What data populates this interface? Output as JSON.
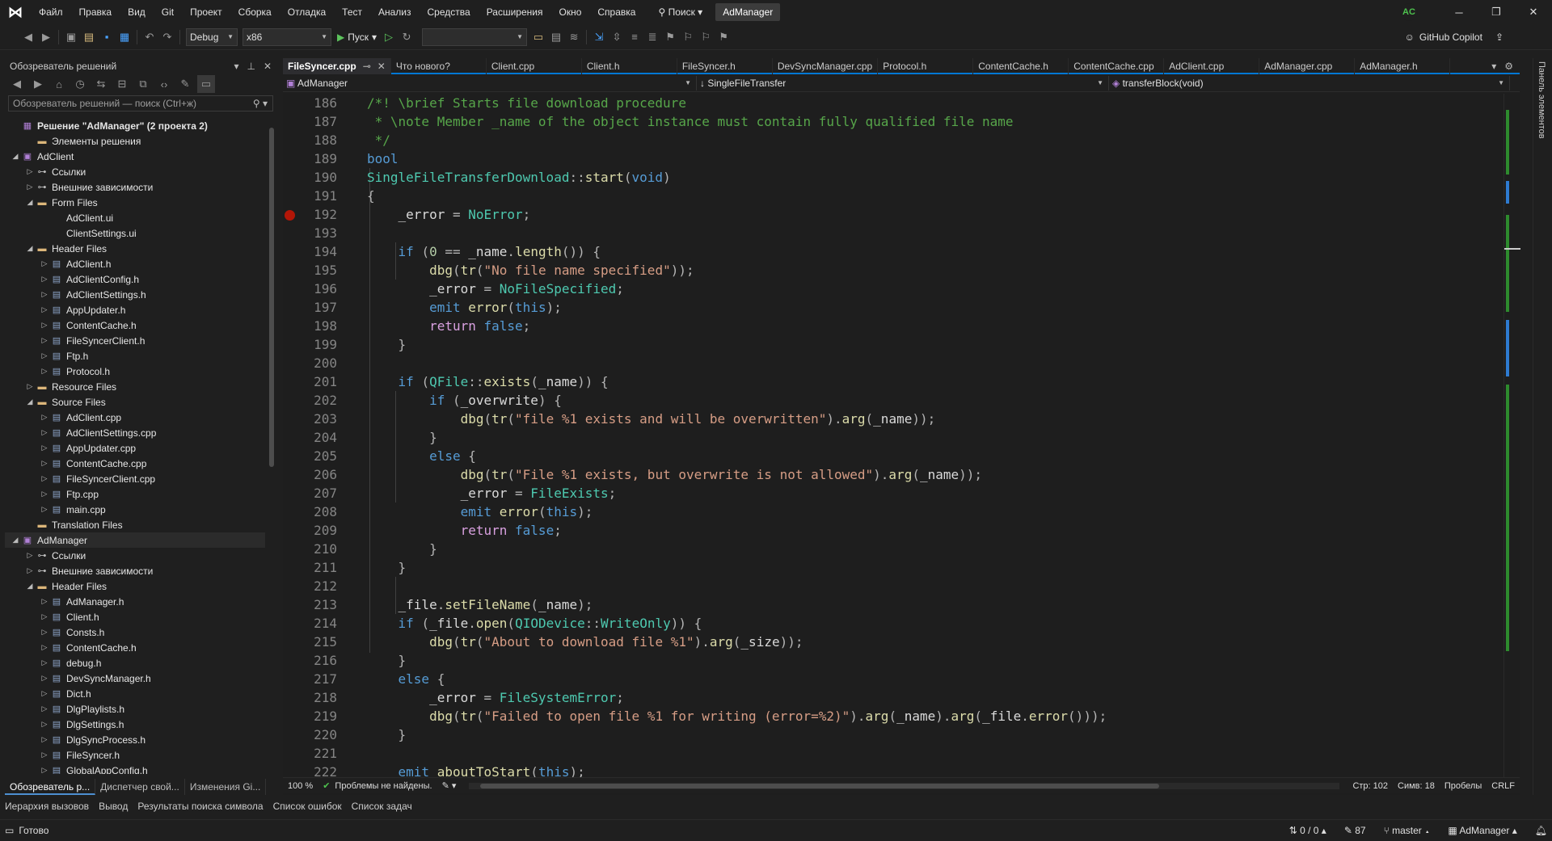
{
  "menu": [
    "Файл",
    "Правка",
    "Вид",
    "Git",
    "Проект",
    "Сборка",
    "Отладка",
    "Тест",
    "Анализ",
    "Средства",
    "Расширения",
    "Окно",
    "Справка"
  ],
  "search_label": "Поиск",
  "app_title": "AdManager",
  "user_initials": "AC",
  "toolbar": {
    "config": "Debug",
    "platform": "x86",
    "run_label": "Пуск",
    "copilot_label": "GitHub Copilot"
  },
  "solution_explorer": {
    "title": "Обозреватель решений",
    "search_placeholder": "Обозреватель решений — поиск (Ctrl+ж)",
    "tree": [
      {
        "t": "Решение \"AdManager\"  (2 проекта 2)",
        "lvl": 0,
        "kind": "sol",
        "exp": "",
        "bold": true
      },
      {
        "t": "Элементы решения",
        "lvl": 1,
        "kind": "folder",
        "exp": ""
      },
      {
        "t": "AdClient",
        "lvl": 0,
        "kind": "proj",
        "exp": "◢"
      },
      {
        "t": "Ссылки",
        "lvl": 1,
        "kind": "ref",
        "exp": "▷"
      },
      {
        "t": "Внешние зависимости",
        "lvl": 1,
        "kind": "ref",
        "exp": "▷"
      },
      {
        "t": "Form Files",
        "lvl": 1,
        "kind": "folder",
        "exp": "◢"
      },
      {
        "t": "AdClient.ui",
        "lvl": 2,
        "kind": "none",
        "exp": ""
      },
      {
        "t": "ClientSettings.ui",
        "lvl": 2,
        "kind": "none",
        "exp": ""
      },
      {
        "t": "Header Files",
        "lvl": 1,
        "kind": "folder",
        "exp": "◢"
      },
      {
        "t": "AdClient.h",
        "lvl": 2,
        "kind": "file",
        "exp": "▷"
      },
      {
        "t": "AdClientConfig.h",
        "lvl": 2,
        "kind": "file",
        "exp": "▷"
      },
      {
        "t": "AdClientSettings.h",
        "lvl": 2,
        "kind": "file",
        "exp": "▷"
      },
      {
        "t": "AppUpdater.h",
        "lvl": 2,
        "kind": "file",
        "exp": "▷"
      },
      {
        "t": "ContentCache.h",
        "lvl": 2,
        "kind": "file",
        "exp": "▷"
      },
      {
        "t": "FileSyncerClient.h",
        "lvl": 2,
        "kind": "file",
        "exp": "▷"
      },
      {
        "t": "Ftp.h",
        "lvl": 2,
        "kind": "file",
        "exp": "▷"
      },
      {
        "t": "Protocol.h",
        "lvl": 2,
        "kind": "file",
        "exp": "▷"
      },
      {
        "t": "Resource Files",
        "lvl": 1,
        "kind": "folder",
        "exp": "▷"
      },
      {
        "t": "Source Files",
        "lvl": 1,
        "kind": "folder",
        "exp": "◢"
      },
      {
        "t": "AdClient.cpp",
        "lvl": 2,
        "kind": "file",
        "exp": "▷"
      },
      {
        "t": "AdClientSettings.cpp",
        "lvl": 2,
        "kind": "file",
        "exp": "▷"
      },
      {
        "t": "AppUpdater.cpp",
        "lvl": 2,
        "kind": "file",
        "exp": "▷"
      },
      {
        "t": "ContentCache.cpp",
        "lvl": 2,
        "kind": "file",
        "exp": "▷"
      },
      {
        "t": "FileSyncerClient.cpp",
        "lvl": 2,
        "kind": "file",
        "exp": "▷"
      },
      {
        "t": "Ftp.cpp",
        "lvl": 2,
        "kind": "file",
        "exp": "▷"
      },
      {
        "t": "main.cpp",
        "lvl": 2,
        "kind": "file",
        "exp": "▷"
      },
      {
        "t": "Translation Files",
        "lvl": 1,
        "kind": "folder",
        "exp": ""
      },
      {
        "t": "AdManager",
        "lvl": 0,
        "kind": "proj",
        "exp": "◢",
        "selected": true
      },
      {
        "t": "Ссылки",
        "lvl": 1,
        "kind": "ref",
        "exp": "▷"
      },
      {
        "t": "Внешние зависимости",
        "lvl": 1,
        "kind": "ref",
        "exp": "▷"
      },
      {
        "t": "Header Files",
        "lvl": 1,
        "kind": "folder",
        "exp": "◢"
      },
      {
        "t": "AdManager.h",
        "lvl": 2,
        "kind": "file",
        "exp": "▷"
      },
      {
        "t": "Client.h",
        "lvl": 2,
        "kind": "file",
        "exp": "▷"
      },
      {
        "t": "Consts.h",
        "lvl": 2,
        "kind": "file",
        "exp": "▷"
      },
      {
        "t": "ContentCache.h",
        "lvl": 2,
        "kind": "file",
        "exp": "▷"
      },
      {
        "t": "debug.h",
        "lvl": 2,
        "kind": "file",
        "exp": "▷"
      },
      {
        "t": "DevSyncManager.h",
        "lvl": 2,
        "kind": "file",
        "exp": "▷"
      },
      {
        "t": "Dict.h",
        "lvl": 2,
        "kind": "file",
        "exp": "▷"
      },
      {
        "t": "DlgPlaylists.h",
        "lvl": 2,
        "kind": "file",
        "exp": "▷"
      },
      {
        "t": "DlgSettings.h",
        "lvl": 2,
        "kind": "file",
        "exp": "▷"
      },
      {
        "t": "DlgSyncProcess.h",
        "lvl": 2,
        "kind": "file",
        "exp": "▷"
      },
      {
        "t": "FileSyncer.h",
        "lvl": 2,
        "kind": "file",
        "exp": "▷"
      },
      {
        "t": "GlobalAppConfig.h",
        "lvl": 2,
        "kind": "file",
        "exp": "▷"
      }
    ],
    "tabs": [
      "Обозреватель р...",
      "Диспетчер свой...",
      "Изменения Gi..."
    ]
  },
  "doc_tabs": [
    "FileSyncer.cpp",
    "Что нового?",
    "Client.cpp",
    "Client.h",
    "FileSyncer.h",
    "DevSyncManager.cpp",
    "Protocol.h",
    "ContentCache.h",
    "ContentCache.cpp",
    "AdClient.cpp",
    "AdManager.cpp",
    "AdManager.h"
  ],
  "nav": {
    "project": "AdManager",
    "scope": "SingleFileTransfer",
    "member": "transferBlock(void)"
  },
  "code": [
    {
      "n": "186",
      "s": [
        [
          "c-com",
          "/*! \\brief Starts file download procedure"
        ]
      ]
    },
    {
      "n": "187",
      "s": [
        [
          "c-com",
          " * \\note Member _name of the object instance must contain fully qualified file name"
        ]
      ]
    },
    {
      "n": "188",
      "s": [
        [
          "c-com",
          " */"
        ]
      ]
    },
    {
      "n": "189",
      "s": [
        [
          "c-kw",
          "bool"
        ]
      ]
    },
    {
      "n": "190",
      "s": [
        [
          "c-ty",
          "SingleFileTransferDownload"
        ],
        [
          "c-punc",
          "::"
        ],
        [
          "c-fn",
          "start"
        ],
        [
          "c-punc",
          "("
        ],
        [
          "c-kw",
          "void"
        ],
        [
          "c-punc",
          ")"
        ]
      ]
    },
    {
      "n": "191",
      "s": [
        [
          "c-punc",
          "{"
        ]
      ]
    },
    {
      "n": "192",
      "bp": true,
      "s": [
        [
          "c-var",
          "    _error "
        ],
        [
          "c-punc",
          "= "
        ],
        [
          "c-ty",
          "NoError"
        ],
        [
          "c-punc",
          ";"
        ]
      ]
    },
    {
      "n": "193",
      "s": []
    },
    {
      "n": "194",
      "s": [
        [
          "c-kw",
          "    if "
        ],
        [
          "c-punc",
          "("
        ],
        [
          "c-num",
          "0"
        ],
        [
          "c-punc",
          " == "
        ],
        [
          "c-var",
          "_name"
        ],
        [
          "c-punc",
          "."
        ],
        [
          "c-fn",
          "length"
        ],
        [
          "c-punc",
          "()) {"
        ]
      ]
    },
    {
      "n": "195",
      "s": [
        [
          "c-fn",
          "        dbg"
        ],
        [
          "c-punc",
          "("
        ],
        [
          "c-fn",
          "tr"
        ],
        [
          "c-punc",
          "("
        ],
        [
          "c-str",
          "\"No file name specified\""
        ],
        [
          "c-punc",
          "));"
        ]
      ]
    },
    {
      "n": "196",
      "s": [
        [
          "c-var",
          "        _error "
        ],
        [
          "c-punc",
          "= "
        ],
        [
          "c-ty",
          "NoFileSpecified"
        ],
        [
          "c-punc",
          ";"
        ]
      ]
    },
    {
      "n": "197",
      "s": [
        [
          "c-kw",
          "        emit "
        ],
        [
          "c-fn",
          "error"
        ],
        [
          "c-punc",
          "("
        ],
        [
          "c-kw",
          "this"
        ],
        [
          "c-punc",
          ");"
        ]
      ]
    },
    {
      "n": "198",
      "s": [
        [
          "c-ctrl",
          "        return "
        ],
        [
          "c-kw",
          "false"
        ],
        [
          "c-punc",
          ";"
        ]
      ]
    },
    {
      "n": "199",
      "s": [
        [
          "c-punc",
          "    }"
        ]
      ]
    },
    {
      "n": "200",
      "s": []
    },
    {
      "n": "201",
      "s": [
        [
          "c-kw",
          "    if "
        ],
        [
          "c-punc",
          "("
        ],
        [
          "c-ty",
          "QFile"
        ],
        [
          "c-punc",
          "::"
        ],
        [
          "c-fn",
          "exists"
        ],
        [
          "c-punc",
          "("
        ],
        [
          "c-var",
          "_name"
        ],
        [
          "c-punc",
          ")) {"
        ]
      ]
    },
    {
      "n": "202",
      "s": [
        [
          "c-kw",
          "        if "
        ],
        [
          "c-punc",
          "("
        ],
        [
          "c-var",
          "_overwrite"
        ],
        [
          "c-punc",
          ") {"
        ]
      ]
    },
    {
      "n": "203",
      "s": [
        [
          "c-fn",
          "            dbg"
        ],
        [
          "c-punc",
          "("
        ],
        [
          "c-fn",
          "tr"
        ],
        [
          "c-punc",
          "("
        ],
        [
          "c-str",
          "\"file %1 exists and will be overwritten\""
        ],
        [
          "c-punc",
          ")."
        ],
        [
          "c-fn",
          "arg"
        ],
        [
          "c-punc",
          "("
        ],
        [
          "c-var",
          "_name"
        ],
        [
          "c-punc",
          "));"
        ]
      ]
    },
    {
      "n": "204",
      "s": [
        [
          "c-punc",
          "        }"
        ]
      ]
    },
    {
      "n": "205",
      "s": [
        [
          "c-kw",
          "        else "
        ],
        [
          "c-punc",
          "{"
        ]
      ]
    },
    {
      "n": "206",
      "s": [
        [
          "c-fn",
          "            dbg"
        ],
        [
          "c-punc",
          "("
        ],
        [
          "c-fn",
          "tr"
        ],
        [
          "c-punc",
          "("
        ],
        [
          "c-str",
          "\"File %1 exists, but overwrite is not allowed\""
        ],
        [
          "c-punc",
          ")."
        ],
        [
          "c-fn",
          "arg"
        ],
        [
          "c-punc",
          "("
        ],
        [
          "c-var",
          "_name"
        ],
        [
          "c-punc",
          "));"
        ]
      ]
    },
    {
      "n": "207",
      "s": [
        [
          "c-var",
          "            _error "
        ],
        [
          "c-punc",
          "= "
        ],
        [
          "c-ty",
          "FileExists"
        ],
        [
          "c-punc",
          ";"
        ]
      ]
    },
    {
      "n": "208",
      "s": [
        [
          "c-kw",
          "            emit "
        ],
        [
          "c-fn",
          "error"
        ],
        [
          "c-punc",
          "("
        ],
        [
          "c-kw",
          "this"
        ],
        [
          "c-punc",
          ");"
        ]
      ]
    },
    {
      "n": "209",
      "s": [
        [
          "c-ctrl",
          "            return "
        ],
        [
          "c-kw",
          "false"
        ],
        [
          "c-punc",
          ";"
        ]
      ]
    },
    {
      "n": "210",
      "s": [
        [
          "c-punc",
          "        }"
        ]
      ]
    },
    {
      "n": "211",
      "s": [
        [
          "c-punc",
          "    }"
        ]
      ]
    },
    {
      "n": "212",
      "s": []
    },
    {
      "n": "213",
      "s": [
        [
          "c-var",
          "    _file"
        ],
        [
          "c-punc",
          "."
        ],
        [
          "c-fn",
          "setFileName"
        ],
        [
          "c-punc",
          "("
        ],
        [
          "c-var",
          "_name"
        ],
        [
          "c-punc",
          ");"
        ]
      ]
    },
    {
      "n": "214",
      "s": [
        [
          "c-kw",
          "    if "
        ],
        [
          "c-punc",
          "("
        ],
        [
          "c-var",
          "_file"
        ],
        [
          "c-punc",
          "."
        ],
        [
          "c-fn",
          "open"
        ],
        [
          "c-punc",
          "("
        ],
        [
          "c-ty",
          "QIODevice"
        ],
        [
          "c-punc",
          "::"
        ],
        [
          "c-ty",
          "WriteOnly"
        ],
        [
          "c-punc",
          ")) {"
        ]
      ]
    },
    {
      "n": "215",
      "s": [
        [
          "c-fn",
          "        dbg"
        ],
        [
          "c-punc",
          "("
        ],
        [
          "c-fn",
          "tr"
        ],
        [
          "c-punc",
          "("
        ],
        [
          "c-str",
          "\"About to download file %1\""
        ],
        [
          "c-punc",
          ")."
        ],
        [
          "c-fn",
          "arg"
        ],
        [
          "c-punc",
          "("
        ],
        [
          "c-var",
          "_size"
        ],
        [
          "c-punc",
          "));"
        ]
      ]
    },
    {
      "n": "216",
      "s": [
        [
          "c-punc",
          "    }"
        ]
      ]
    },
    {
      "n": "217",
      "s": [
        [
          "c-kw",
          "    else "
        ],
        [
          "c-punc",
          "{"
        ]
      ]
    },
    {
      "n": "218",
      "s": [
        [
          "c-var",
          "        _error "
        ],
        [
          "c-punc",
          "= "
        ],
        [
          "c-ty",
          "FileSystemError"
        ],
        [
          "c-punc",
          ";"
        ]
      ]
    },
    {
      "n": "219",
      "s": [
        [
          "c-fn",
          "        dbg"
        ],
        [
          "c-punc",
          "("
        ],
        [
          "c-fn",
          "tr"
        ],
        [
          "c-punc",
          "("
        ],
        [
          "c-str",
          "\"Failed to open file %1 for writing (error=%2)\""
        ],
        [
          "c-punc",
          ")."
        ],
        [
          "c-fn",
          "arg"
        ],
        [
          "c-punc",
          "("
        ],
        [
          "c-var",
          "_name"
        ],
        [
          "c-punc",
          ")."
        ],
        [
          "c-fn",
          "arg"
        ],
        [
          "c-punc",
          "("
        ],
        [
          "c-var",
          "_file"
        ],
        [
          "c-punc",
          "."
        ],
        [
          "c-fn",
          "error"
        ],
        [
          "c-punc",
          "()));"
        ]
      ]
    },
    {
      "n": "220",
      "s": [
        [
          "c-punc",
          "    }"
        ]
      ]
    },
    {
      "n": "221",
      "s": []
    },
    {
      "n": "222",
      "s": [
        [
          "c-kw",
          "    emit "
        ],
        [
          "c-fn",
          "aboutToStart"
        ],
        [
          "c-punc",
          "("
        ],
        [
          "c-kw",
          "this"
        ],
        [
          "c-punc",
          ");"
        ]
      ]
    }
  ],
  "editor_status": {
    "zoom": "100 %",
    "problems": "Проблемы не найдены.",
    "line": "Стр: 102",
    "col": "Симв: 18",
    "whitespace": "Пробелы",
    "eol": "CRLF"
  },
  "right_panel_label": "Панель элементов",
  "bottom_tabs": [
    "Иерархия вызовов",
    "Вывод",
    "Результаты поиска символа",
    "Список ошибок",
    "Список задач"
  ],
  "status": {
    "ready": "Готово",
    "updown": "0 / 0",
    "edits": "87",
    "branch": "master",
    "repo": "AdManager"
  }
}
